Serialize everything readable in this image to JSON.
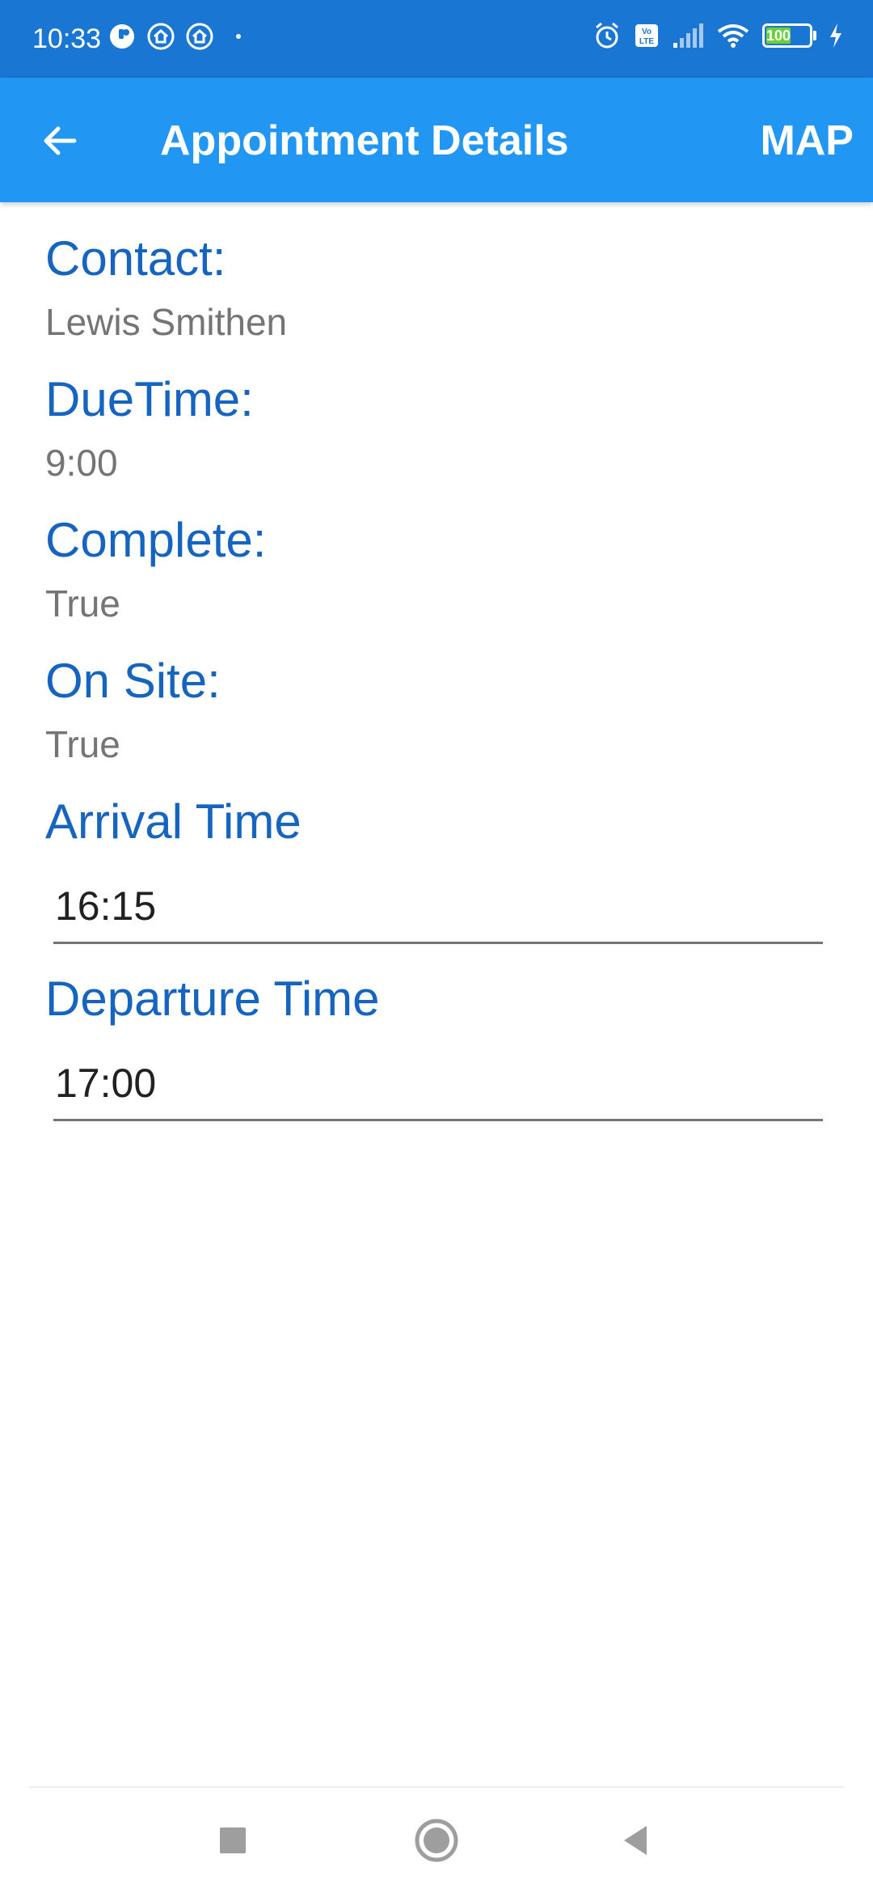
{
  "status_bar": {
    "time": "10:33",
    "battery_level": "100",
    "icons": [
      "notification-icon",
      "home-icon",
      "home-icon",
      "dot-icon",
      "alarm-icon",
      "volte-icon",
      "signal-icon",
      "wifi-icon",
      "battery-icon",
      "charging-icon"
    ]
  },
  "app_bar": {
    "title": "Appointment Details",
    "action": "MAP",
    "back_icon": "back-arrow-icon"
  },
  "details": {
    "contact_label": "Contact:",
    "contact_value": "Lewis Smithen",
    "due_time_label": "DueTime:",
    "due_time_value": "9:00",
    "complete_label": "Complete:",
    "complete_value": "True",
    "on_site_label": "On Site:",
    "on_site_value": "True",
    "arrival_label": "Arrival Time",
    "arrival_value": "16:15",
    "departure_label": "Departure Time",
    "departure_value": "17:00"
  },
  "colors": {
    "status_bar": "#1976d2",
    "app_bar": "#2196f3",
    "label": "#1565c0",
    "value": "#757575",
    "battery_fill": "#6ccf3a"
  },
  "nav": {
    "icons": [
      "recents-square-icon",
      "home-circle-icon",
      "back-triangle-icon"
    ]
  }
}
